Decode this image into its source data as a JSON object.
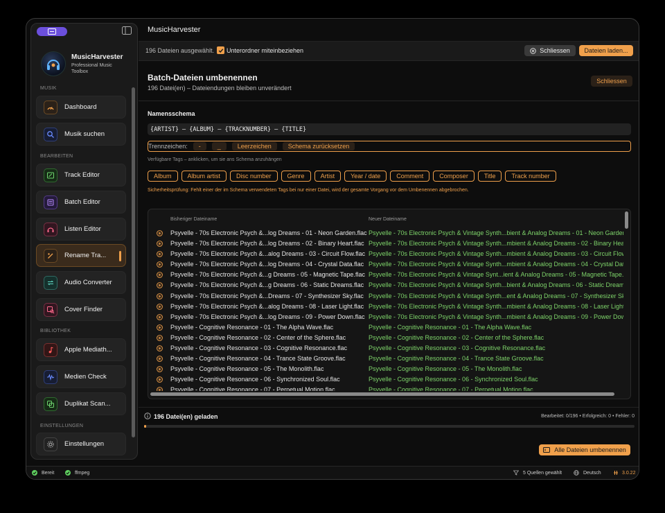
{
  "app": {
    "title": "MusicHarvester"
  },
  "brand": {
    "name": "MusicHarvester",
    "subtitle": "Professional Music Toolbox"
  },
  "sidebar": {
    "sections": {
      "musik": "MUSIK",
      "bearbeiten": "BEARBEITEN",
      "bibliothek": "BIBLIOTHEK",
      "einstellungen": "EINSTELLUNGEN"
    },
    "items": [
      {
        "label": "Dashboard",
        "icon": "gauge-icon",
        "color": "#f0a04b"
      },
      {
        "label": "Musik suchen",
        "icon": "search-icon",
        "color": "#6a8cff"
      },
      {
        "label": "Track Editor",
        "icon": "tag-edit-icon",
        "color": "#6fd46f"
      },
      {
        "label": "Batch Editor",
        "icon": "list-icon",
        "color": "#b88cff"
      },
      {
        "label": "Listen Editor",
        "icon": "headphones-icon",
        "color": "#ff6a8c"
      },
      {
        "label": "Rename Tra...",
        "icon": "rename-icon",
        "color": "#f0a04b"
      },
      {
        "label": "Audio Converter",
        "icon": "convert-icon",
        "color": "#5fd4c0"
      },
      {
        "label": "Cover Finder",
        "icon": "image-search-icon",
        "color": "#ff6a8c"
      },
      {
        "label": "Apple Mediath...",
        "icon": "music-note-icon",
        "color": "#ff5a5a"
      },
      {
        "label": "Medien Check",
        "icon": "waveform-icon",
        "color": "#6a8cff"
      },
      {
        "label": "Duplikat Scan...",
        "icon": "duplicate-icon",
        "color": "#6fd46f"
      },
      {
        "label": "Einstellungen",
        "icon": "gear-icon",
        "color": "#bbbbbb"
      }
    ]
  },
  "toolbar": {
    "selected": "196 Dateien ausgewählt.",
    "include_sub": "Unterordner miteinbeziehen",
    "close": "Schliessen",
    "load": "Dateien laden..."
  },
  "panel": {
    "title": "Batch-Dateien umbenennen",
    "subtitle": "196 Datei(en) – Dateiendungen bleiben unverändert",
    "close": "Schliessen",
    "schema_title": "Namensschema",
    "schema_value": "{ARTIST} – {ALBUM} – {TRACKNUMBER} – {TITLE}",
    "separator_label": "Trennzeichen:",
    "separators": [
      "-",
      "_",
      "Leerzeichen",
      "Schema zurücksetzen"
    ],
    "tags_hint": "Verfügbare Tags – anklicken, um sie ans Schema anzuhängen",
    "tags": [
      "Album",
      "Album artist",
      "Disc number",
      "Genre",
      "Artist",
      "Year / date",
      "Comment",
      "Composer",
      "Title",
      "Track number"
    ],
    "safety": "Sicherheitsprüfung: Fehlt einer der im Schema verwendeten Tags bei nur einer Datei, wird der gesamte Vorgang vor dem Umbenennen abgebrochen."
  },
  "table": {
    "col_old": "Bisheriger Dateiname",
    "col_new": "Neuer Dateiname",
    "rows": [
      {
        "old": "Psyvelle - 70s Electronic Psych &...log Dreams - 01 - Neon Garden.flac",
        "new": "Psyvelle - 70s Electronic Psych & Vintage Synth...bient & Analog Dreams - 01 - Neon Garden.fl"
      },
      {
        "old": "Psyvelle - 70s Electronic Psych &...log Dreams - 02 - Binary Heart.flac",
        "new": "Psyvelle - 70s Electronic Psych & Vintage Synth...mbient & Analog Dreams - 02 - Binary Heart.f"
      },
      {
        "old": "Psyvelle - 70s Electronic Psych &...alog Dreams - 03 - Circuit Flow.flac",
        "new": "Psyvelle - 70s Electronic Psych & Vintage Synth...mbient & Analog Dreams - 03 - Circuit Flow.fl"
      },
      {
        "old": "Psyvelle - 70s Electronic Psych &...log Dreams - 04 - Crystal Data.flac",
        "new": "Psyvelle - 70s Electronic Psych & Vintage Synth...mbient & Analog Dreams - 04 - Crystal Data."
      },
      {
        "old": "Psyvelle - 70s Electronic Psych &...g Dreams - 05 - Magnetic Tape.flac",
        "new": "Psyvelle - 70s Electronic Psych & Vintage Synt...ient & Analog Dreams - 05 - Magnetic Tape.fl"
      },
      {
        "old": "Psyvelle - 70s Electronic Psych &...g Dreams - 06 - Static Dreams.flac",
        "new": "Psyvelle - 70s Electronic Psych & Vintage Synth...bient & Analog Dreams - 06 - Static Dreams.fl"
      },
      {
        "old": "Psyvelle - 70s Electronic Psych &...Dreams - 07 - Synthesizer Sky.flac",
        "new": "Psyvelle - 70s Electronic Psych & Vintage Synth...ent & Analog Dreams - 07 - Synthesizer Sky."
      },
      {
        "old": "Psyvelle - 70s Electronic Psych &...alog Dreams - 08 - Laser Light.flac",
        "new": "Psyvelle - 70s Electronic Psych & Vintage Synth...mbient & Analog Dreams - 08 - Laser Light.flac"
      },
      {
        "old": "Psyvelle - 70s Electronic Psych &...log Dreams - 09 - Power Down.flac",
        "new": "Psyvelle - 70s Electronic Psych & Vintage Synth...mbient & Analog Dreams - 09 - Power Down.f"
      },
      {
        "old": "Psyvelle - Cognitive Resonance - 01 - The Alpha Wave.flac",
        "new": "Psyvelle - Cognitive Resonance - 01 - The Alpha Wave.flac"
      },
      {
        "old": "Psyvelle - Cognitive Resonance - 02 - Center of the Sphere.flac",
        "new": "Psyvelle - Cognitive Resonance - 02 - Center of the Sphere.flac"
      },
      {
        "old": "Psyvelle - Cognitive Resonance - 03 - Cognitive Resonance.flac",
        "new": "Psyvelle - Cognitive Resonance - 03 - Cognitive Resonance.flac"
      },
      {
        "old": "Psyvelle - Cognitive Resonance - 04 - Trance State Groove.flac",
        "new": "Psyvelle - Cognitive Resonance - 04 - Trance State Groove.flac"
      },
      {
        "old": "Psyvelle - Cognitive Resonance - 05 - The Monolith.flac",
        "new": "Psyvelle - Cognitive Resonance - 05 - The Monolith.flac"
      },
      {
        "old": "Psyvelle - Cognitive Resonance - 06 - Synchronized Soul.flac",
        "new": "Psyvelle - Cognitive Resonance - 06 - Synchronized Soul.flac"
      },
      {
        "old": "Psyvelle - Cognitive Resonance - 07 - Perpetual Motion.flac",
        "new": "Psyvelle - Cognitive Resonance - 07 - Perpetual Motion.flac"
      }
    ]
  },
  "status": {
    "loaded": "196 Datei(en) geladen",
    "progress_text": "Bearbeitet: 0/196  •  Erfolgreich: 0  •  Fehler: 0",
    "progress": 0.004,
    "rename_all": "Alle Dateien umbenennen"
  },
  "statusbar": {
    "ready": "Bereit",
    "ffmpeg": "ffmpeg",
    "sources": "5 Quellen gewählt",
    "language": "Deutsch",
    "version": "3.0.22"
  },
  "colors": {
    "accent": "#f0a04b",
    "success": "#7ed46a",
    "pill": "#6b4fdc"
  }
}
